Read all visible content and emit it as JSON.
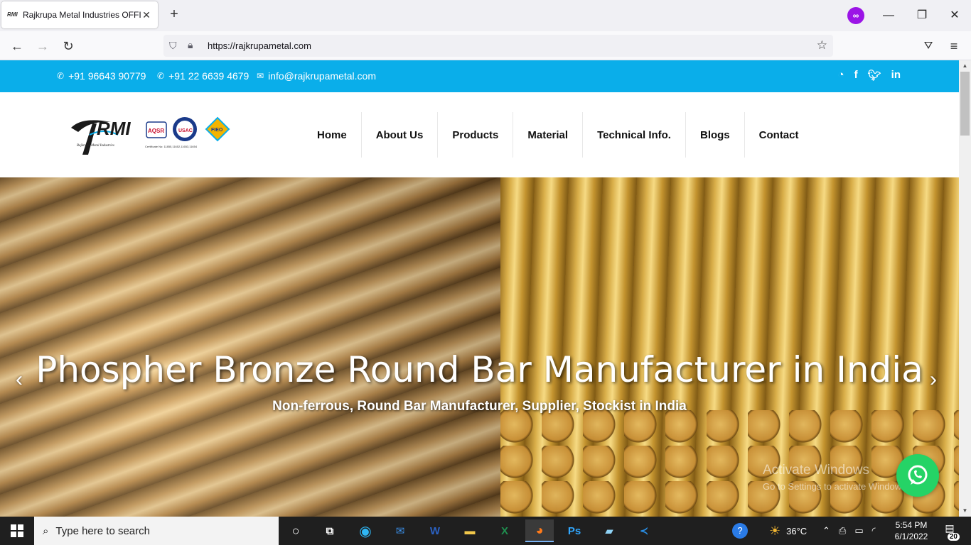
{
  "browser": {
    "tab_title": "Rajkrupa Metal Industries OFFICIAL",
    "tab_favicon_text": "RMI",
    "url": "https://rajkrupametal.com",
    "icons": [
      "back-icon",
      "forward-icon",
      "reload-icon",
      "shield-icon",
      "lock-icon",
      "star-icon",
      "pocket-icon",
      "menu-icon"
    ]
  },
  "topbar": {
    "phone1": "+91 96643 90779",
    "phone2": "+91 22 6639 4679",
    "email": "info@rajkrupametal.com",
    "social": [
      "whatsapp-icon",
      "facebook-icon",
      "twitter-icon",
      "linkedin-icon"
    ],
    "color": "#0aaeea"
  },
  "logo": {
    "brand": "RMI",
    "tagline": "Rajkrupa Metal Industries",
    "badge1": "AQSR",
    "badge2": "USAC",
    "badge3": "FIEO",
    "cert_text": "Certificate No: 11855,11652,11653,11654"
  },
  "menu": [
    "Home",
    "About Us",
    "Products",
    "Material",
    "Technical Info.",
    "Blogs",
    "Contact"
  ],
  "hero": {
    "headline": "Phospher Bronze Round Bar Manufacturer in India",
    "subheadline": "Non-ferrous, Round Bar Manufacturer, Supplier, Stockist in India",
    "prev": "‹",
    "next": "›"
  },
  "watermark": {
    "line1": "Activate Windows",
    "line2": "Go to Settings to activate Windows."
  },
  "taskbar": {
    "search_placeholder": "Type here to search",
    "apps": [
      "cortana-icon",
      "task-view-icon",
      "edge-icon",
      "mail-icon",
      "word-icon",
      "file-explorer-icon",
      "excel-icon",
      "firefox-icon",
      "photoshop-icon",
      "notepad-icon",
      "vscode-icon"
    ],
    "temperature": "36°C",
    "time": "5:54 PM",
    "date": "6/1/2022",
    "notifications": "20"
  }
}
